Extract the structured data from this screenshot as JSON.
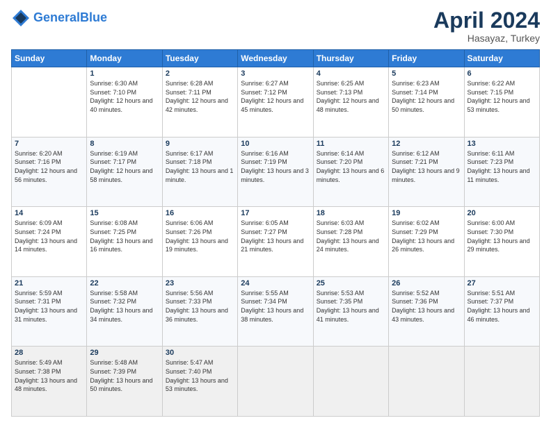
{
  "header": {
    "logo_line1": "General",
    "logo_line2": "Blue",
    "month": "April 2024",
    "location": "Hasayaz, Turkey"
  },
  "days_of_week": [
    "Sunday",
    "Monday",
    "Tuesday",
    "Wednesday",
    "Thursday",
    "Friday",
    "Saturday"
  ],
  "weeks": [
    [
      {
        "num": "",
        "sunrise": "",
        "sunset": "",
        "daylight": ""
      },
      {
        "num": "1",
        "sunrise": "Sunrise: 6:30 AM",
        "sunset": "Sunset: 7:10 PM",
        "daylight": "Daylight: 12 hours and 40 minutes."
      },
      {
        "num": "2",
        "sunrise": "Sunrise: 6:28 AM",
        "sunset": "Sunset: 7:11 PM",
        "daylight": "Daylight: 12 hours and 42 minutes."
      },
      {
        "num": "3",
        "sunrise": "Sunrise: 6:27 AM",
        "sunset": "Sunset: 7:12 PM",
        "daylight": "Daylight: 12 hours and 45 minutes."
      },
      {
        "num": "4",
        "sunrise": "Sunrise: 6:25 AM",
        "sunset": "Sunset: 7:13 PM",
        "daylight": "Daylight: 12 hours and 48 minutes."
      },
      {
        "num": "5",
        "sunrise": "Sunrise: 6:23 AM",
        "sunset": "Sunset: 7:14 PM",
        "daylight": "Daylight: 12 hours and 50 minutes."
      },
      {
        "num": "6",
        "sunrise": "Sunrise: 6:22 AM",
        "sunset": "Sunset: 7:15 PM",
        "daylight": "Daylight: 12 hours and 53 minutes."
      }
    ],
    [
      {
        "num": "7",
        "sunrise": "Sunrise: 6:20 AM",
        "sunset": "Sunset: 7:16 PM",
        "daylight": "Daylight: 12 hours and 56 minutes."
      },
      {
        "num": "8",
        "sunrise": "Sunrise: 6:19 AM",
        "sunset": "Sunset: 7:17 PM",
        "daylight": "Daylight: 12 hours and 58 minutes."
      },
      {
        "num": "9",
        "sunrise": "Sunrise: 6:17 AM",
        "sunset": "Sunset: 7:18 PM",
        "daylight": "Daylight: 13 hours and 1 minute."
      },
      {
        "num": "10",
        "sunrise": "Sunrise: 6:16 AM",
        "sunset": "Sunset: 7:19 PM",
        "daylight": "Daylight: 13 hours and 3 minutes."
      },
      {
        "num": "11",
        "sunrise": "Sunrise: 6:14 AM",
        "sunset": "Sunset: 7:20 PM",
        "daylight": "Daylight: 13 hours and 6 minutes."
      },
      {
        "num": "12",
        "sunrise": "Sunrise: 6:12 AM",
        "sunset": "Sunset: 7:21 PM",
        "daylight": "Daylight: 13 hours and 9 minutes."
      },
      {
        "num": "13",
        "sunrise": "Sunrise: 6:11 AM",
        "sunset": "Sunset: 7:23 PM",
        "daylight": "Daylight: 13 hours and 11 minutes."
      }
    ],
    [
      {
        "num": "14",
        "sunrise": "Sunrise: 6:09 AM",
        "sunset": "Sunset: 7:24 PM",
        "daylight": "Daylight: 13 hours and 14 minutes."
      },
      {
        "num": "15",
        "sunrise": "Sunrise: 6:08 AM",
        "sunset": "Sunset: 7:25 PM",
        "daylight": "Daylight: 13 hours and 16 minutes."
      },
      {
        "num": "16",
        "sunrise": "Sunrise: 6:06 AM",
        "sunset": "Sunset: 7:26 PM",
        "daylight": "Daylight: 13 hours and 19 minutes."
      },
      {
        "num": "17",
        "sunrise": "Sunrise: 6:05 AM",
        "sunset": "Sunset: 7:27 PM",
        "daylight": "Daylight: 13 hours and 21 minutes."
      },
      {
        "num": "18",
        "sunrise": "Sunrise: 6:03 AM",
        "sunset": "Sunset: 7:28 PM",
        "daylight": "Daylight: 13 hours and 24 minutes."
      },
      {
        "num": "19",
        "sunrise": "Sunrise: 6:02 AM",
        "sunset": "Sunset: 7:29 PM",
        "daylight": "Daylight: 13 hours and 26 minutes."
      },
      {
        "num": "20",
        "sunrise": "Sunrise: 6:00 AM",
        "sunset": "Sunset: 7:30 PM",
        "daylight": "Daylight: 13 hours and 29 minutes."
      }
    ],
    [
      {
        "num": "21",
        "sunrise": "Sunrise: 5:59 AM",
        "sunset": "Sunset: 7:31 PM",
        "daylight": "Daylight: 13 hours and 31 minutes."
      },
      {
        "num": "22",
        "sunrise": "Sunrise: 5:58 AM",
        "sunset": "Sunset: 7:32 PM",
        "daylight": "Daylight: 13 hours and 34 minutes."
      },
      {
        "num": "23",
        "sunrise": "Sunrise: 5:56 AM",
        "sunset": "Sunset: 7:33 PM",
        "daylight": "Daylight: 13 hours and 36 minutes."
      },
      {
        "num": "24",
        "sunrise": "Sunrise: 5:55 AM",
        "sunset": "Sunset: 7:34 PM",
        "daylight": "Daylight: 13 hours and 38 minutes."
      },
      {
        "num": "25",
        "sunrise": "Sunrise: 5:53 AM",
        "sunset": "Sunset: 7:35 PM",
        "daylight": "Daylight: 13 hours and 41 minutes."
      },
      {
        "num": "26",
        "sunrise": "Sunrise: 5:52 AM",
        "sunset": "Sunset: 7:36 PM",
        "daylight": "Daylight: 13 hours and 43 minutes."
      },
      {
        "num": "27",
        "sunrise": "Sunrise: 5:51 AM",
        "sunset": "Sunset: 7:37 PM",
        "daylight": "Daylight: 13 hours and 46 minutes."
      }
    ],
    [
      {
        "num": "28",
        "sunrise": "Sunrise: 5:49 AM",
        "sunset": "Sunset: 7:38 PM",
        "daylight": "Daylight: 13 hours and 48 minutes."
      },
      {
        "num": "29",
        "sunrise": "Sunrise: 5:48 AM",
        "sunset": "Sunset: 7:39 PM",
        "daylight": "Daylight: 13 hours and 50 minutes."
      },
      {
        "num": "30",
        "sunrise": "Sunrise: 5:47 AM",
        "sunset": "Sunset: 7:40 PM",
        "daylight": "Daylight: 13 hours and 53 minutes."
      },
      {
        "num": "",
        "sunrise": "",
        "sunset": "",
        "daylight": ""
      },
      {
        "num": "",
        "sunrise": "",
        "sunset": "",
        "daylight": ""
      },
      {
        "num": "",
        "sunrise": "",
        "sunset": "",
        "daylight": ""
      },
      {
        "num": "",
        "sunrise": "",
        "sunset": "",
        "daylight": ""
      }
    ]
  ]
}
